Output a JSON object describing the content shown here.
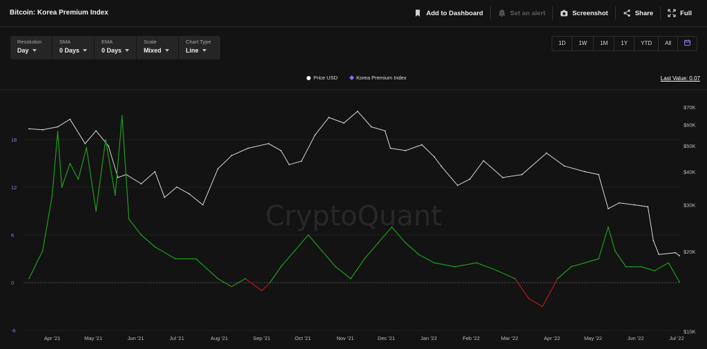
{
  "header": {
    "title": "Bitcoin: Korea Premium Index",
    "actions": [
      {
        "label": "Add to Dashboard",
        "icon": "bookmark-icon",
        "disabled": false
      },
      {
        "label": "Set an alert",
        "icon": "bell-icon",
        "disabled": true
      },
      {
        "label": "Screenshot",
        "icon": "camera-icon",
        "disabled": false
      },
      {
        "label": "Share",
        "icon": "share-icon",
        "disabled": false
      },
      {
        "label": "Full",
        "icon": "fullscreen-icon",
        "disabled": false
      }
    ]
  },
  "controls": [
    {
      "label": "Resolution",
      "value": "Day"
    },
    {
      "label": "SMA",
      "value": "0 Days"
    },
    {
      "label": "EMA",
      "value": "0 Days"
    },
    {
      "label": "Scale",
      "value": "Mixed"
    },
    {
      "label": "Chart Type",
      "value": "Line"
    }
  ],
  "ranges": [
    "1D",
    "1W",
    "1M",
    "1Y",
    "YTD",
    "All"
  ],
  "range_calendar_icon": "calendar-icon",
  "legend": [
    {
      "label": "Price USD",
      "color": "#ffffff",
      "marker": "circle"
    },
    {
      "label": "Korea Premium Index",
      "color": "#8f6cf7",
      "marker": "diamond"
    }
  ],
  "last_value_label": "Last Value: 0.07",
  "watermark": "CryptoQuant",
  "colors": {
    "price": "#d9d9d9",
    "premium_positive": "#1f9d1f",
    "premium_negative": "#c0151c",
    "background": "#131313"
  },
  "chart_data": {
    "type": "line",
    "x_ticks": [
      "Apr '21",
      "May '21",
      "Jun '21",
      "Jul '21",
      "Aug '21",
      "Sep '21",
      "Oct '21",
      "Nov '21",
      "Dec '21",
      "Jan '22",
      "Feb '22",
      "Mar '22",
      "Apr '22",
      "May '22",
      "Jun '22",
      "Jul '22"
    ],
    "y_left": {
      "label": "",
      "ticks": [
        "18",
        "12",
        "6",
        "0",
        "-6"
      ],
      "range": [
        -6,
        24
      ]
    },
    "y_right": {
      "label": "",
      "scale": "log",
      "ticks": [
        "$70K",
        "$60K",
        "$50K",
        "$40K",
        "$30K",
        "$20K",
        "$10K"
      ],
      "range": [
        10000,
        80000
      ]
    },
    "series": [
      {
        "name": "Price USD",
        "axis": "right",
        "x": [
          "2021-03-15",
          "2021-03-25",
          "2021-04-05",
          "2021-04-14",
          "2021-04-25",
          "2021-05-03",
          "2021-05-12",
          "2021-05-19",
          "2021-05-25",
          "2021-06-05",
          "2021-06-15",
          "2021-06-22",
          "2021-07-01",
          "2021-07-10",
          "2021-07-20",
          "2021-07-31",
          "2021-08-10",
          "2021-08-22",
          "2021-09-06",
          "2021-09-15",
          "2021-09-21",
          "2021-09-30",
          "2021-10-10",
          "2021-10-20",
          "2021-10-31",
          "2021-11-10",
          "2021-11-20",
          "2021-11-30",
          "2021-12-04",
          "2021-12-15",
          "2021-12-27",
          "2022-01-05",
          "2022-01-10",
          "2022-01-22",
          "2022-01-31",
          "2022-02-10",
          "2022-02-24",
          "2022-03-10",
          "2022-03-28",
          "2022-04-10",
          "2022-04-25",
          "2022-05-05",
          "2022-05-12",
          "2022-05-20",
          "2022-05-31",
          "2022-06-10",
          "2022-06-14",
          "2022-06-18",
          "2022-06-30",
          "2022-07-03"
        ],
        "y": [
          58000,
          57500,
          59000,
          63000,
          51000,
          57000,
          50000,
          38000,
          39000,
          36000,
          40000,
          32000,
          35000,
          33000,
          30000,
          41000,
          46000,
          49000,
          51000,
          48000,
          42500,
          43800,
          55000,
          64000,
          61000,
          67500,
          59000,
          57000,
          49000,
          48000,
          50500,
          45500,
          42000,
          35500,
          37500,
          44000,
          38000,
          39000,
          47000,
          42000,
          40000,
          39000,
          29000,
          30500,
          30000,
          29500,
          22000,
          19500,
          19800,
          19300
        ]
      },
      {
        "name": "Korea Premium Index",
        "axis": "left",
        "x": [
          "2021-03-15",
          "2021-03-25",
          "2021-04-01",
          "2021-04-05",
          "2021-04-08",
          "2021-04-14",
          "2021-04-20",
          "2021-04-26",
          "2021-05-03",
          "2021-05-10",
          "2021-05-17",
          "2021-05-22",
          "2021-05-27",
          "2021-06-05",
          "2021-06-15",
          "2021-06-30",
          "2021-07-15",
          "2021-07-31",
          "2021-08-10",
          "2021-08-20",
          "2021-09-01",
          "2021-09-07",
          "2021-09-15",
          "2021-09-25",
          "2021-10-05",
          "2021-10-15",
          "2021-10-25",
          "2021-11-05",
          "2021-11-15",
          "2021-11-25",
          "2021-12-05",
          "2021-12-15",
          "2021-12-25",
          "2022-01-05",
          "2022-01-20",
          "2022-02-05",
          "2022-02-20",
          "2022-03-05",
          "2022-03-15",
          "2022-03-25",
          "2022-04-05",
          "2022-04-15",
          "2022-04-25",
          "2022-05-05",
          "2022-05-12",
          "2022-05-17",
          "2022-05-25",
          "2022-06-05",
          "2022-06-15",
          "2022-06-25",
          "2022-07-03"
        ],
        "y": [
          0.5,
          4,
          11,
          19,
          12,
          15,
          13,
          17,
          9,
          18,
          11,
          21,
          8,
          6,
          4.5,
          3,
          3,
          0.5,
          -0.5,
          0.5,
          -1,
          0,
          2,
          4,
          6,
          4,
          2,
          0.5,
          3,
          5,
          7,
          5,
          3.5,
          2.5,
          2,
          2.5,
          1.5,
          0.5,
          -2,
          -3,
          0.5,
          2,
          2.5,
          3,
          7,
          4,
          2,
          2,
          1.5,
          2.5,
          0.1
        ]
      }
    ]
  }
}
